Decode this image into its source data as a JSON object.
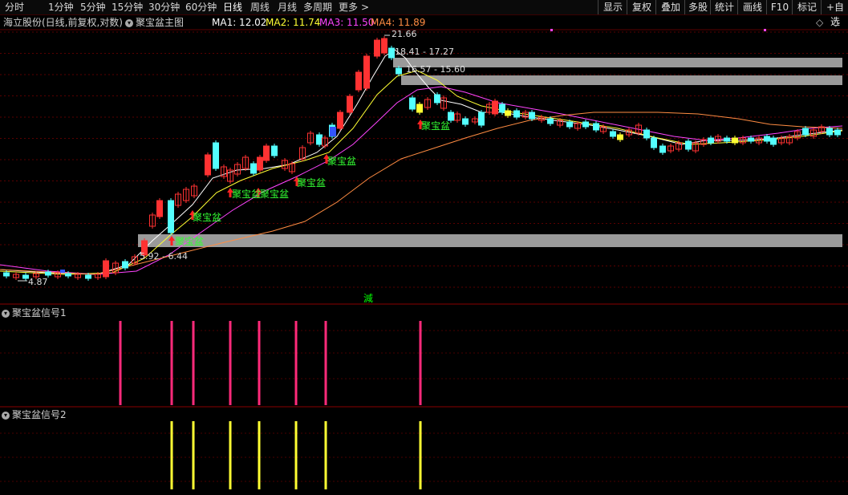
{
  "toolbar": {
    "periods": [
      "分时",
      "1分钟",
      "5分钟",
      "15分钟",
      "30分钟",
      "60分钟",
      "日线",
      "周线",
      "月线",
      "多周期",
      "更多"
    ],
    "active": "日线",
    "more_arrow": ">",
    "right_buttons": [
      "显示",
      "复权",
      "叠加",
      "多股",
      "统计",
      "画线",
      "F10",
      "标记",
      "+自选"
    ]
  },
  "legend": {
    "stock": "海立股份(日线,前复权,对数)",
    "indicator": "聚宝盆主图",
    "ma": [
      {
        "label": "MA1: 12.02",
        "color": "#ffffff"
      },
      {
        "label": "MA2: 11.74",
        "color": "#ffff33"
      },
      {
        "label": "MA3: 11.50",
        "color": "#ff44ff"
      },
      {
        "label": "MA4: 11.89",
        "color": "#ff8c42"
      }
    ]
  },
  "main_chart": {
    "price_labels": [
      {
        "text": "21.66",
        "kind": "high"
      },
      {
        "text": "18.41 - 17.27",
        "kind": "band"
      },
      {
        "text": "16.57 - 15.60",
        "kind": "band"
      },
      {
        "text": "5.92 - 6.44",
        "kind": "band"
      },
      {
        "text": "4.87",
        "kind": "low"
      }
    ],
    "signal_text": "聚宝盆",
    "marker_text": "減",
    "colors": {
      "up": "#ff3232",
      "down": "#54ffff",
      "signal": "#00ff00",
      "band": "#9a9a9a"
    }
  },
  "panel1": {
    "title": "聚宝盆信号1",
    "color": "#ff2a7a"
  },
  "panel2": {
    "title": "聚宝盆信号2",
    "color": "#ffff33"
  }
}
